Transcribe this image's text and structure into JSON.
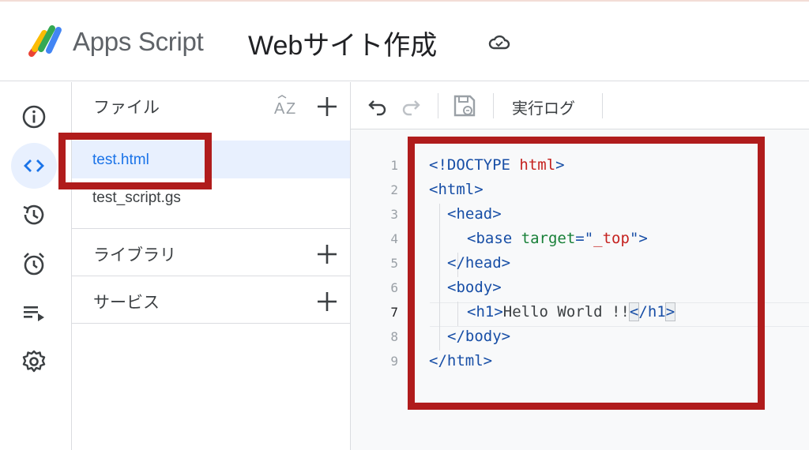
{
  "header": {
    "app_name": "Apps Script",
    "project_title": "Webサイト作成"
  },
  "rail": {
    "items": [
      "info-icon",
      "code-icon",
      "history-icon",
      "alarm-icon",
      "executions-icon",
      "settings-icon"
    ],
    "active": "code-icon"
  },
  "files_panel": {
    "title": "ファイル",
    "files": [
      {
        "name": "test.html",
        "selected": true
      },
      {
        "name": "test_script.gs",
        "selected": false
      }
    ],
    "libraries_label": "ライブラリ",
    "services_label": "サービス"
  },
  "toolbar": {
    "run_log_label": "実行ログ"
  },
  "code": {
    "current_line": 7,
    "lines": [
      {
        "n": "1",
        "text": "<!DOCTYPE html>"
      },
      {
        "n": "2",
        "text": "<html>"
      },
      {
        "n": "3",
        "text": "<head>"
      },
      {
        "n": "4",
        "text": "<base target=\"_top\">"
      },
      {
        "n": "5",
        "text": "</head>"
      },
      {
        "n": "6",
        "text": "<body>"
      },
      {
        "n": "7",
        "text": "<h1>Hello World !!</h1>"
      },
      {
        "n": "8",
        "text": "</body>"
      },
      {
        "n": "9",
        "text": "</html>"
      }
    ]
  },
  "colors": {
    "accent": "#1a73e8",
    "highlight_box": "#b01c1c",
    "selected_bg": "#e8f0fe"
  }
}
